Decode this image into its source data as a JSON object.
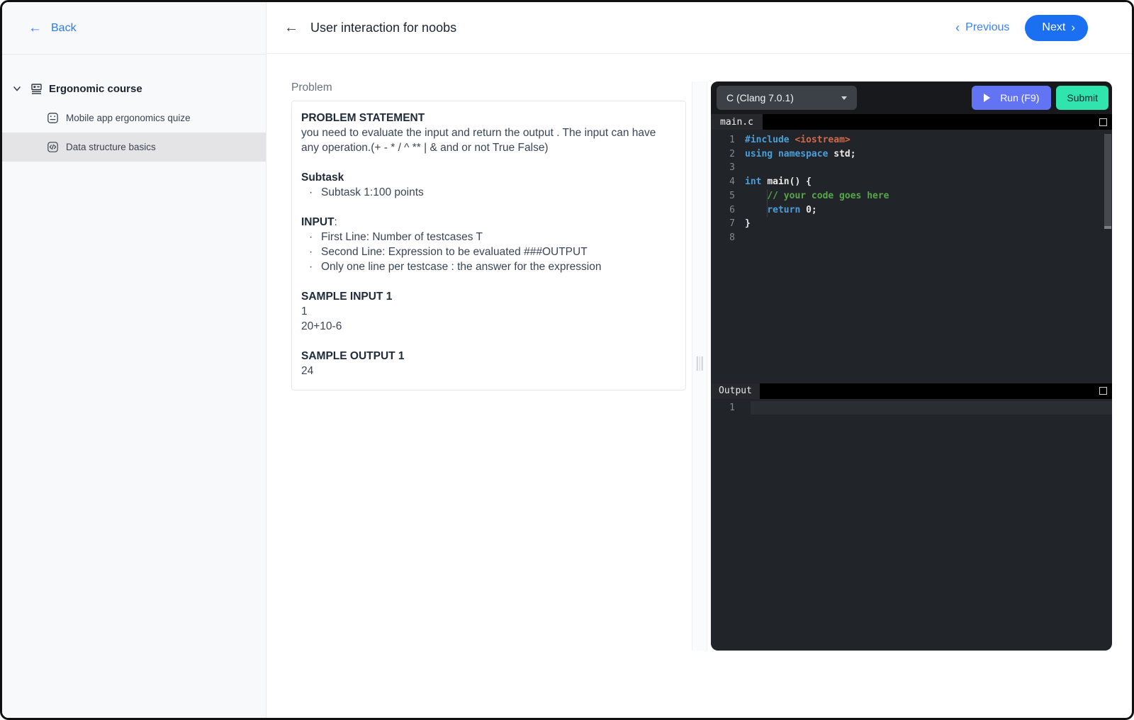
{
  "sidebar": {
    "back_label": "Back",
    "course_label": "Ergonomic course",
    "items": [
      {
        "label": "Mobile app ergonomics quize",
        "icon": "quiz-icon"
      },
      {
        "label": "Data structure basics",
        "icon": "code-icon"
      }
    ]
  },
  "header": {
    "title": "User interaction for noobs",
    "previous_label": "Previous",
    "next_label": "Next"
  },
  "problem": {
    "section_label": "Problem",
    "blocks": [
      {
        "type": "h",
        "text": "PROBLEM STATEMENT"
      },
      {
        "type": "p",
        "lines": [
          "you need to evaluate the input and return the output . The input can have any operation.(+ - * / ^ ** | & and or not True False)"
        ]
      },
      {
        "type": "gap"
      },
      {
        "type": "h",
        "text": "Subtask"
      },
      {
        "type": "bullets",
        "items": [
          "Subtask 1:100 points"
        ]
      },
      {
        "type": "gap"
      },
      {
        "type": "h",
        "text": "INPUT",
        "suffix": ":"
      },
      {
        "type": "bullets",
        "items": [
          "First Line: Number of testcases T",
          "Second Line: Expression to be evaluated ###OUTPUT",
          "Only one line per testcase : the answer for the expression"
        ]
      },
      {
        "type": "gap"
      },
      {
        "type": "h",
        "text": "SAMPLE INPUT 1"
      },
      {
        "type": "p",
        "lines": [
          "1",
          "20+10-6"
        ]
      },
      {
        "type": "gap"
      },
      {
        "type": "h",
        "text": "SAMPLE OUTPUT 1"
      },
      {
        "type": "p",
        "lines": [
          "24"
        ]
      }
    ]
  },
  "editor": {
    "language_selected": "C (Clang 7.0.1)",
    "run_label": "Run (F9)",
    "submit_label": "Submit",
    "file_tab": "main.c",
    "code_lines": [
      {
        "n": "1",
        "toks": [
          [
            "kw",
            "#include"
          ],
          [
            "pl",
            " "
          ],
          [
            "str",
            "<iostream>"
          ]
        ]
      },
      {
        "n": "2",
        "toks": [
          [
            "kw",
            "using"
          ],
          [
            "pl",
            " "
          ],
          [
            "kw",
            "namespace"
          ],
          [
            "pl",
            " "
          ],
          [
            "txt",
            "std;"
          ]
        ]
      },
      {
        "n": "3",
        "toks": []
      },
      {
        "n": "4",
        "toks": [
          [
            "kw",
            "int"
          ],
          [
            "pl",
            " "
          ],
          [
            "txt",
            "main() {"
          ]
        ]
      },
      {
        "n": "5",
        "toks": [
          [
            "pl",
            "    "
          ],
          [
            "cmt",
            "// your code goes here"
          ]
        ]
      },
      {
        "n": "6",
        "toks": [
          [
            "pl",
            "    "
          ],
          [
            "kw",
            "return"
          ],
          [
            "pl",
            " "
          ],
          [
            "txt",
            "0;"
          ]
        ]
      },
      {
        "n": "7",
        "toks": [
          [
            "txt",
            "}"
          ]
        ]
      },
      {
        "n": "8",
        "toks": []
      }
    ],
    "output_tab": "Output",
    "output_lines": [
      {
        "number": "1",
        "text": ""
      }
    ]
  },
  "colors": {
    "accent_blue": "#1a70f0",
    "link_blue": "#3b82f4",
    "run_blue": "#6274f3",
    "submit_teal": "#30e5ad",
    "keyword": "#4b9fd8",
    "string": "#cf6a4c",
    "comment": "#57a64a",
    "selected_item_bg": "#e4e4e6"
  }
}
